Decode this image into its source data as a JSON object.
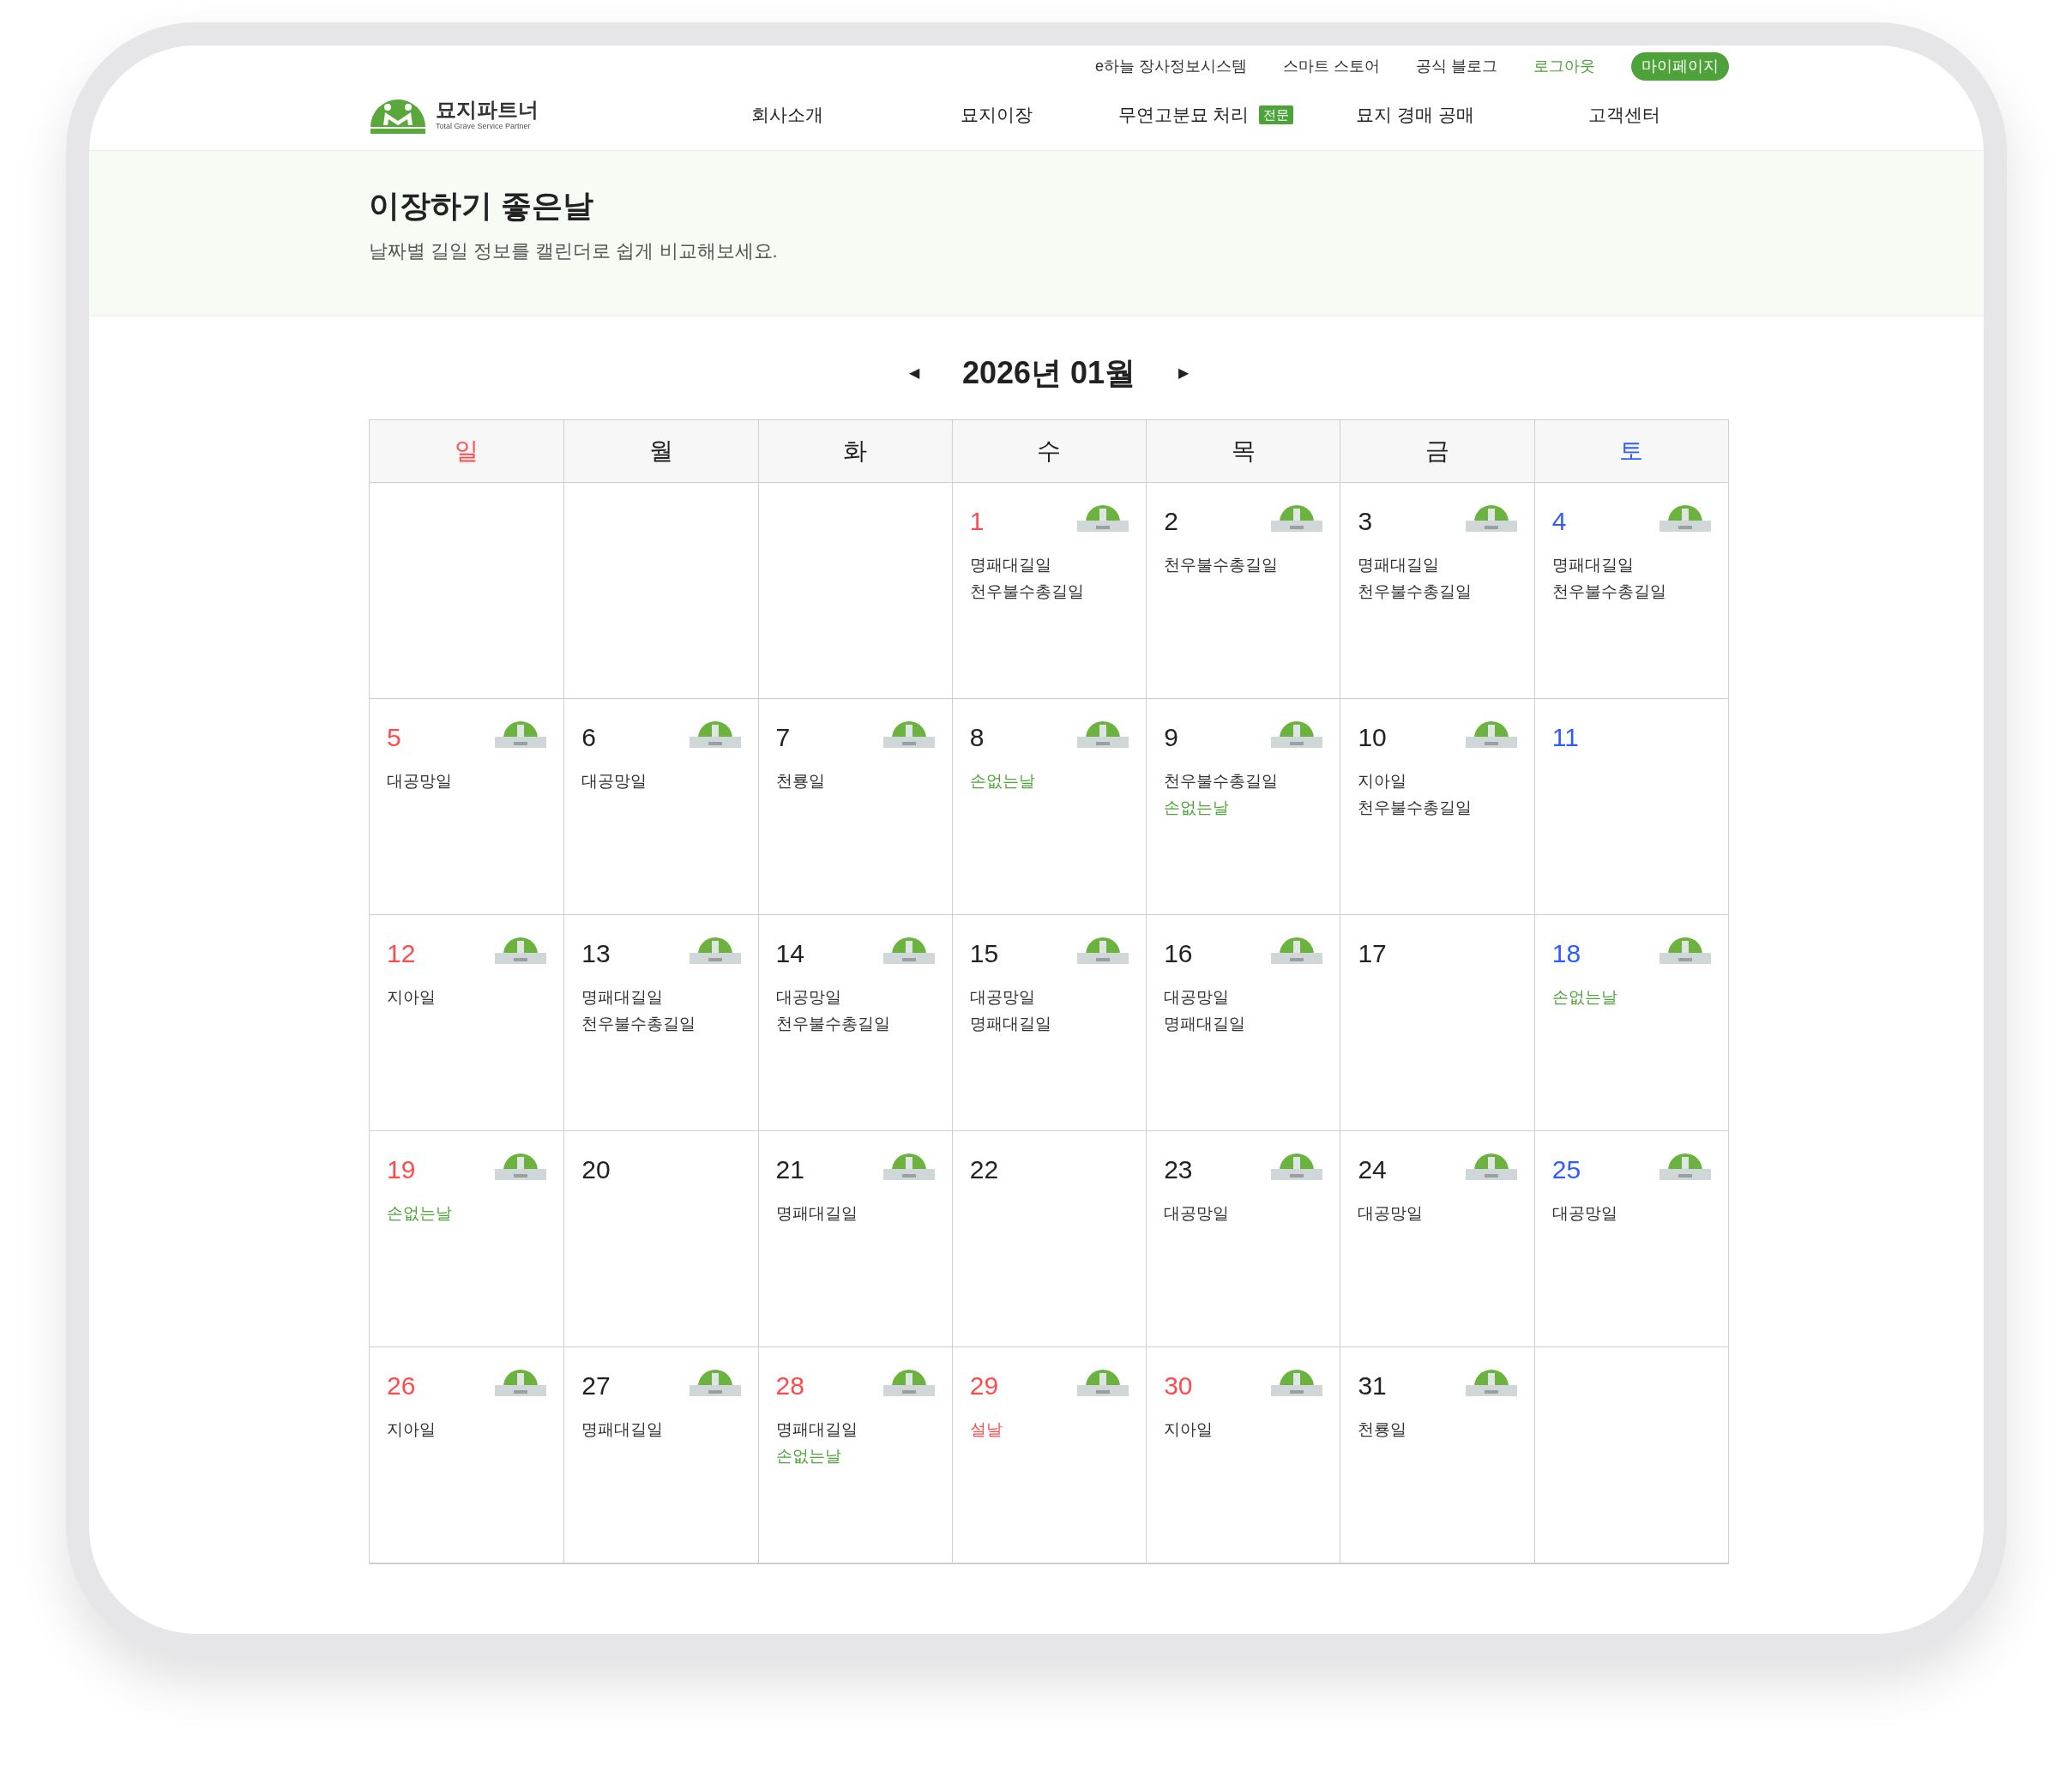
{
  "top_links": [
    {
      "label": "e하늘 장사정보시스템",
      "kind": "link"
    },
    {
      "label": "스마트 스토어",
      "kind": "link"
    },
    {
      "label": "공식 블로그",
      "kind": "link"
    },
    {
      "label": "로그아웃",
      "kind": "accent"
    },
    {
      "label": "마이페이지",
      "kind": "pill"
    }
  ],
  "logo": {
    "name": "묘지파트너",
    "tagline": "Total Grave Service Partner"
  },
  "nav": [
    {
      "label": "회사소개"
    },
    {
      "label": "묘지이장"
    },
    {
      "label": "무연고분묘 처리",
      "badge": "전문"
    },
    {
      "label": "묘지 경매 공매"
    },
    {
      "label": "고객센터"
    }
  ],
  "hero": {
    "title": "이장하기 좋은날",
    "subtitle": "날짜별 길일 정보를 캘린더로 쉽게 비교해보세요."
  },
  "month": {
    "prev": "◀",
    "label": "2026년 01월",
    "next": "▶"
  },
  "weekdays": [
    {
      "label": "일",
      "color": "#ff4b4b"
    },
    {
      "label": "월",
      "color": "#222222"
    },
    {
      "label": "화",
      "color": "#222222"
    },
    {
      "label": "수",
      "color": "#222222"
    },
    {
      "label": "목",
      "color": "#222222"
    },
    {
      "label": "금",
      "color": "#222222"
    },
    {
      "label": "토",
      "color": "#2f5bff"
    }
  ],
  "weeks": [
    [
      {
        "kind": "empty"
      },
      {
        "kind": "empty"
      },
      {
        "kind": "empty"
      },
      {
        "kind": "day",
        "day": "1",
        "color": "#ff4b4b",
        "lamp": true,
        "labels": [
          {
            "text": "명패대길일",
            "kind": "plain"
          },
          {
            "text": "천우불수총길일",
            "kind": "plain"
          }
        ]
      },
      {
        "kind": "day",
        "day": "2",
        "color": "#222222",
        "lamp": true,
        "labels": [
          {
            "text": "천우불수총길일",
            "kind": "plain"
          }
        ]
      },
      {
        "kind": "day",
        "day": "3",
        "color": "#222222",
        "lamp": true,
        "labels": [
          {
            "text": "명패대길일",
            "kind": "plain"
          },
          {
            "text": "천우불수총길일",
            "kind": "plain"
          }
        ]
      },
      {
        "kind": "day",
        "day": "4",
        "color": "#2f5bff",
        "lamp": true,
        "labels": [
          {
            "text": "명패대길일",
            "kind": "plain"
          },
          {
            "text": "천우불수총길일",
            "kind": "plain"
          }
        ]
      }
    ],
    [
      {
        "kind": "day",
        "day": "5",
        "color": "#ff4b4b",
        "lamp": true,
        "labels": [
          {
            "text": "대공망일",
            "kind": "plain"
          }
        ]
      },
      {
        "kind": "day",
        "day": "6",
        "color": "#222222",
        "lamp": true,
        "labels": [
          {
            "text": "대공망일",
            "kind": "plain"
          }
        ]
      },
      {
        "kind": "day",
        "day": "7",
        "color": "#222222",
        "lamp": true,
        "labels": [
          {
            "text": "천룡일",
            "kind": "plain"
          }
        ]
      },
      {
        "kind": "day",
        "day": "8",
        "color": "#222222",
        "lamp": true,
        "labels": [
          {
            "text": "손없는날",
            "kind": "good"
          }
        ]
      },
      {
        "kind": "day",
        "day": "9",
        "color": "#222222",
        "lamp": true,
        "labels": [
          {
            "text": "천우불수총길일",
            "kind": "plain"
          },
          {
            "text": "손없는날",
            "kind": "good"
          }
        ]
      },
      {
        "kind": "day",
        "day": "10",
        "color": "#222222",
        "lamp": true,
        "labels": [
          {
            "text": "지아일",
            "kind": "plain"
          },
          {
            "text": "천우불수총길일",
            "kind": "plain"
          }
        ]
      },
      {
        "kind": "day",
        "day": "11",
        "color": "#2f5bff",
        "lamp": false
      }
    ],
    [
      {
        "kind": "day",
        "day": "12",
        "color": "#ff4b4b",
        "lamp": true,
        "labels": [
          {
            "text": "지아일",
            "kind": "plain"
          }
        ]
      },
      {
        "kind": "day",
        "day": "13",
        "color": "#222222",
        "lamp": true,
        "labels": [
          {
            "text": "명패대길일",
            "kind": "plain"
          },
          {
            "text": "천우불수총길일",
            "kind": "plain"
          }
        ]
      },
      {
        "kind": "day",
        "day": "14",
        "color": "#222222",
        "lamp": true,
        "labels": [
          {
            "text": "대공망일",
            "kind": "plain"
          },
          {
            "text": "천우불수총길일",
            "kind": "plain"
          }
        ]
      },
      {
        "kind": "day",
        "day": "15",
        "color": "#222222",
        "lamp": true,
        "labels": [
          {
            "text": "대공망일",
            "kind": "plain"
          },
          {
            "text": "명패대길일",
            "kind": "plain"
          }
        ]
      },
      {
        "kind": "day",
        "day": "16",
        "color": "#222222",
        "lamp": true,
        "labels": [
          {
            "text": "대공망일",
            "kind": "plain"
          },
          {
            "text": "명패대길일",
            "kind": "plain"
          }
        ]
      },
      {
        "kind": "day",
        "day": "17",
        "color": "#222222",
        "lamp": false
      },
      {
        "kind": "day",
        "day": "18",
        "color": "#2f5bff",
        "lamp": true,
        "labels": [
          {
            "text": "손없는날",
            "kind": "good"
          }
        ]
      }
    ],
    [
      {
        "kind": "day",
        "day": "19",
        "color": "#ff4b4b",
        "lamp": true,
        "labels": [
          {
            "text": "손없는날",
            "kind": "good"
          }
        ]
      },
      {
        "kind": "day",
        "day": "20",
        "color": "#222222",
        "lamp": false
      },
      {
        "kind": "day",
        "day": "21",
        "color": "#222222",
        "lamp": true,
        "labels": [
          {
            "text": "명패대길일",
            "kind": "plain"
          }
        ]
      },
      {
        "kind": "day",
        "day": "22",
        "color": "#222222",
        "lamp": false
      },
      {
        "kind": "day",
        "day": "23",
        "color": "#222222",
        "lamp": true,
        "labels": [
          {
            "text": "대공망일",
            "kind": "plain"
          }
        ]
      },
      {
        "kind": "day",
        "day": "24",
        "color": "#222222",
        "lamp": true,
        "labels": [
          {
            "text": "대공망일",
            "kind": "plain"
          }
        ]
      },
      {
        "kind": "day",
        "day": "25",
        "color": "#2f5bff",
        "lamp": true,
        "labels": [
          {
            "text": "대공망일",
            "kind": "plain"
          }
        ]
      }
    ],
    [
      {
        "kind": "day",
        "day": "26",
        "color": "#ff4b4b",
        "lamp": true,
        "labels": [
          {
            "text": "지아일",
            "kind": "plain"
          }
        ]
      },
      {
        "kind": "day",
        "day": "27",
        "color": "#222222",
        "lamp": true,
        "labels": [
          {
            "text": "명패대길일",
            "kind": "plain"
          }
        ]
      },
      {
        "kind": "day",
        "day": "28",
        "color": "#ff4b4b",
        "lamp": true,
        "labels": [
          {
            "text": "명패대길일",
            "kind": "plain"
          },
          {
            "text": "손없는날",
            "kind": "good"
          }
        ]
      },
      {
        "kind": "day",
        "day": "29",
        "color": "#ff4b4b",
        "lamp": true,
        "labels": [
          {
            "text": "설날",
            "kind": "holiday"
          }
        ]
      },
      {
        "kind": "day",
        "day": "30",
        "color": "#ff4b4b",
        "lamp": true,
        "labels": [
          {
            "text": "지아일",
            "kind": "plain"
          }
        ]
      },
      {
        "kind": "day",
        "day": "31",
        "color": "#222222",
        "lamp": true,
        "labels": [
          {
            "text": "천룡일",
            "kind": "plain"
          }
        ]
      },
      {
        "kind": "empty"
      }
    ]
  ]
}
